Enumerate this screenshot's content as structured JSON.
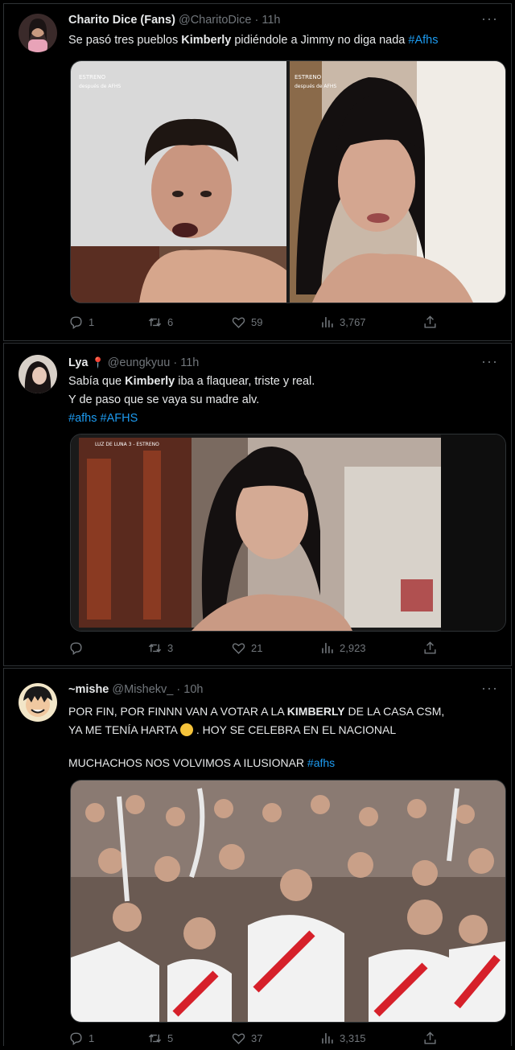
{
  "tweets": [
    {
      "name": "Charito Dice (Fans)",
      "handle": "@CharitoDice",
      "sep": "·",
      "time": "11h",
      "text": {
        "p1": "Se pasó tres pueblos ",
        "kw": "Kimberly",
        "p2": " pidiéndole a  Jimmy no diga nada ",
        "tag": "#Afhs"
      },
      "stats": {
        "replies": "1",
        "retweets": "6",
        "likes": "59",
        "views": "3,767"
      }
    },
    {
      "name": "Lya",
      "handle": "@eungkyuu",
      "sep": "·",
      "time": "11h",
      "text": {
        "p1": "Sabía que ",
        "kw": "Kimberly",
        "p2": " iba a flaquear, triste y real.",
        "line2": "Y de paso que se vaya su madre alv.",
        "tag1": "#afhs",
        "tag2": "#AFHS"
      },
      "stats": {
        "replies": "",
        "retweets": "3",
        "likes": "21",
        "views": "2,923"
      }
    },
    {
      "name": "~mishe",
      "handle": "@Mishekv_",
      "sep": "·",
      "time": "10h",
      "text": {
        "p1": "POR FIN, POR FINNN VAN A VOTAR A LA ",
        "kw": "KIMBERLY",
        "p2": " DE LA CASA CSM,",
        "line2a": "YA ME TENÍA HARTA ",
        "line2b": " . HOY SE CELEBRA EN EL NACIONAL",
        "line3": "MUCHACHOS NOS VOLVIMOS A ILUSIONAR ",
        "tag": "#afhs"
      },
      "stats": {
        "replies": "1",
        "retweets": "5",
        "likes": "37",
        "views": "3,315"
      }
    }
  ],
  "icons": [
    "reply-icon",
    "retweet-icon",
    "like-icon",
    "views-icon",
    "share-icon",
    "more-icon"
  ],
  "colors": {
    "background": "#000000",
    "text": "#e7e9ea",
    "muted": "#71767b",
    "link": "#1d9bf0",
    "border": "#2f3336"
  }
}
